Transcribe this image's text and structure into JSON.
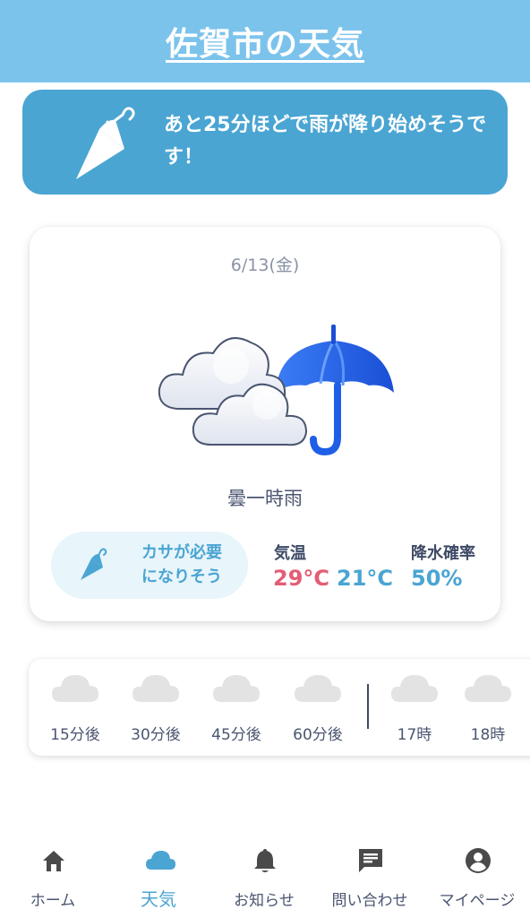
{
  "header": {
    "title": "佐賀市の天気"
  },
  "alert": {
    "message": "あと25分ほどで雨が降り始めそうです！"
  },
  "today": {
    "date": "6/13(金)",
    "condition": "曇一時雨",
    "umbrella_badge": {
      "line1": "カサが必要",
      "line2": "になりそう"
    },
    "temperature": {
      "label": "気温",
      "high": "29°C",
      "low": "21°C"
    },
    "rain_chance": {
      "label": "降水確率",
      "value": "50%"
    }
  },
  "forecast": {
    "items": [
      {
        "label": "15分後",
        "icon": "cloud-icon"
      },
      {
        "label": "30分後",
        "icon": "cloud-icon"
      },
      {
        "label": "45分後",
        "icon": "cloud-icon"
      },
      {
        "label": "60分後",
        "icon": "cloud-icon"
      },
      {
        "label": "17時",
        "icon": "cloud-icon"
      },
      {
        "label": "18時",
        "icon": "cloud-icon"
      }
    ]
  },
  "nav": {
    "items": [
      {
        "label": "ホーム",
        "icon": "home-icon"
      },
      {
        "label": "天気",
        "icon": "cloud-icon",
        "active": true
      },
      {
        "label": "お知らせ",
        "icon": "bell-icon"
      },
      {
        "label": "問い合わせ",
        "icon": "chat-icon"
      },
      {
        "label": "マイページ",
        "icon": "account-icon"
      }
    ]
  },
  "colors": {
    "header_bg": "#7cc3ec",
    "accent": "#4aa5d2",
    "high_temp": "#e35d75",
    "umbrella_blue": "#1f5fe8"
  }
}
